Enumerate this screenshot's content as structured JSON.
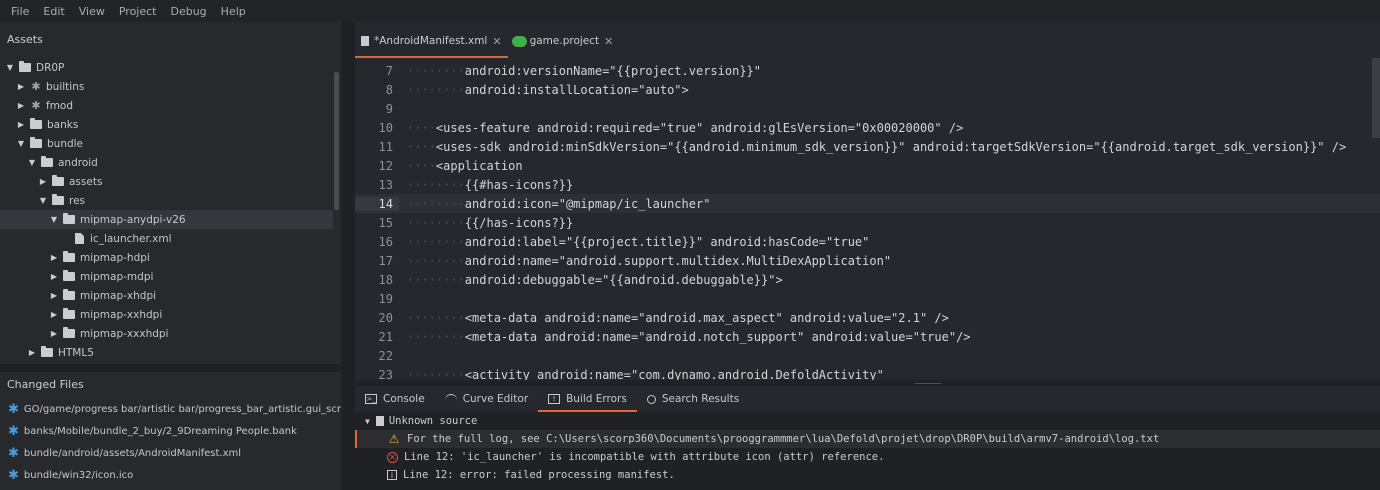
{
  "menu": [
    "File",
    "Edit",
    "View",
    "Project",
    "Debug",
    "Help"
  ],
  "assets": {
    "title": "Assets",
    "tree": [
      {
        "label": "DR0P",
        "type": "folder",
        "depth": 0,
        "expanded": true
      },
      {
        "label": "builtins",
        "type": "lib",
        "depth": 1,
        "expanded": false
      },
      {
        "label": "fmod",
        "type": "lib",
        "depth": 1,
        "expanded": false
      },
      {
        "label": "banks",
        "type": "folder",
        "depth": 1,
        "expanded": false
      },
      {
        "label": "bundle",
        "type": "folder",
        "depth": 1,
        "expanded": true
      },
      {
        "label": "android",
        "type": "folder",
        "depth": 2,
        "expanded": true
      },
      {
        "label": "assets",
        "type": "folder",
        "depth": 3,
        "expanded": false
      },
      {
        "label": "res",
        "type": "folder",
        "depth": 3,
        "expanded": true
      },
      {
        "label": "mipmap-anydpi-v26",
        "type": "folder",
        "depth": 4,
        "expanded": true,
        "selected": true
      },
      {
        "label": "ic_launcher.xml",
        "type": "file",
        "depth": 5
      },
      {
        "label": "mipmap-hdpi",
        "type": "folder",
        "depth": 4,
        "expanded": false
      },
      {
        "label": "mipmap-mdpi",
        "type": "folder",
        "depth": 4,
        "expanded": false
      },
      {
        "label": "mipmap-xhdpi",
        "type": "folder",
        "depth": 4,
        "expanded": false
      },
      {
        "label": "mipmap-xxhdpi",
        "type": "folder",
        "depth": 4,
        "expanded": false
      },
      {
        "label": "mipmap-xxxhdpi",
        "type": "folder",
        "depth": 4,
        "expanded": false
      },
      {
        "label": "HTML5",
        "type": "folder",
        "depth": 2,
        "expanded": false
      }
    ]
  },
  "changed_files": {
    "title": "Changed Files",
    "items": [
      "GO/game/progress bar/artistic bar/progress_bar_artistic.gui_script",
      "banks/Mobile/bundle_2_buy/2_9Dreaming People.bank",
      "bundle/android/assets/AndroidManifest.xml",
      "bundle/win32/icon.ico"
    ]
  },
  "tabs": [
    {
      "label": "*AndroidManifest.xml",
      "icon": "document-icon",
      "active": true
    },
    {
      "label": "game.project",
      "icon": "defold-project-icon",
      "active": false
    }
  ],
  "editor": {
    "current_line": 14,
    "lines": [
      {
        "n": "7",
        "indent": 2,
        "text": "android:versionName=\"{{project.version}}\""
      },
      {
        "n": "8",
        "indent": 2,
        "text": "android:installLocation=\"auto\">"
      },
      {
        "n": "9",
        "indent": 0,
        "text": ""
      },
      {
        "n": "10",
        "indent": 1,
        "text": "<uses-feature android:required=\"true\" android:glEsVersion=\"0x00020000\" />"
      },
      {
        "n": "11",
        "indent": 1,
        "text": "<uses-sdk android:minSdkVersion=\"{{android.minimum_sdk_version}}\" android:targetSdkVersion=\"{{android.target_sdk_version}}\" />"
      },
      {
        "n": "12",
        "indent": 1,
        "text": "<application"
      },
      {
        "n": "13",
        "indent": 2,
        "text": "{{#has-icons?}}"
      },
      {
        "n": "14",
        "indent": 2,
        "text": "android:icon=\"@mipmap/ic_launcher\""
      },
      {
        "n": "15",
        "indent": 2,
        "text": "{{/has-icons?}}"
      },
      {
        "n": "16",
        "indent": 2,
        "text": "android:label=\"{{project.title}}\" android:hasCode=\"true\""
      },
      {
        "n": "17",
        "indent": 2,
        "text": "android:name=\"android.support.multidex.MultiDexApplication\""
      },
      {
        "n": "18",
        "indent": 2,
        "text": "android:debuggable=\"{{android.debuggable}}\">"
      },
      {
        "n": "19",
        "indent": 0,
        "text": ""
      },
      {
        "n": "20",
        "indent": 2,
        "text": "<meta-data android:name=\"android.max_aspect\" android:value=\"2.1\" />"
      },
      {
        "n": "21",
        "indent": 2,
        "text": "<meta-data android:name=\"android.notch_support\" android:value=\"true\"/>"
      },
      {
        "n": "22",
        "indent": 0,
        "text": ""
      },
      {
        "n": "23",
        "indent": 2,
        "text": "<activity android:name=\"com.dynamo.android.DefoldActivity\""
      }
    ]
  },
  "bottom_tabs": [
    {
      "label": "Console",
      "icon": "console-icon",
      "active": false
    },
    {
      "label": "Curve Editor",
      "icon": "curve-icon",
      "active": false
    },
    {
      "label": "Build Errors",
      "icon": "build-errors-icon",
      "active": true
    },
    {
      "label": "Search Results",
      "icon": "search-icon",
      "active": false
    }
  ],
  "build_errors": {
    "group": "Unknown source",
    "items": [
      {
        "level": "warning",
        "text": "For the full log, see C:\\Users\\scorp360\\Documents\\prooggrammmer\\lua\\Defold\\projet\\drop\\DR0P\\build\\armv7-android\\log.txt"
      },
      {
        "level": "error",
        "text": "Line 12: 'ic_launcher' is incompatible with attribute icon (attr) reference."
      },
      {
        "level": "info",
        "text": "Line 12: error: failed processing manifest."
      }
    ]
  },
  "colors": {
    "accent": "#e0663b",
    "changed_star": "#4a9be0",
    "warning": "#e9b53c",
    "error": "#d9534f"
  }
}
